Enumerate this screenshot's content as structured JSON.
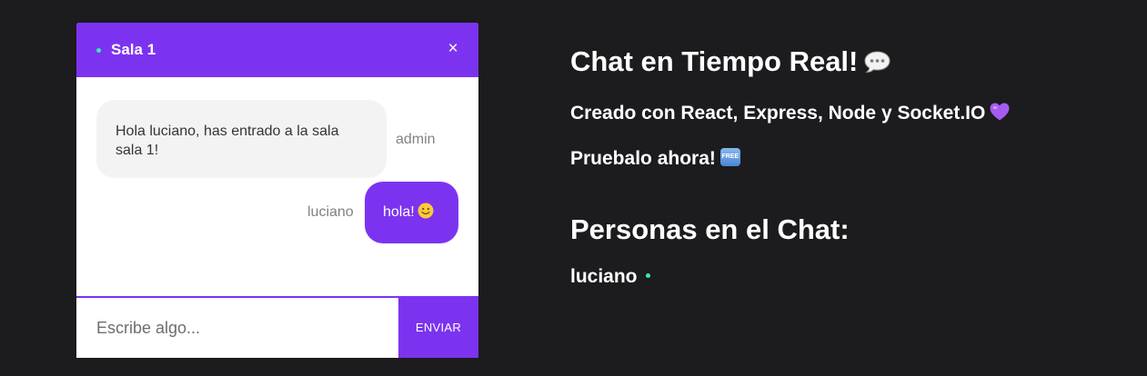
{
  "chat": {
    "room_name": "Sala 1",
    "close_label": "×",
    "messages": [
      {
        "sender": "admin",
        "text": "Hola luciano, has entrado a la sala sala 1!"
      },
      {
        "sender": "luciano",
        "text": "hola!"
      }
    ],
    "input": {
      "value": "",
      "placeholder": "Escribe algo..."
    },
    "send_label": "ENVIAR"
  },
  "info": {
    "title": "Chat en Tiempo Real!",
    "title_icon": "speech-bubble-icon",
    "subtitle": "Creado con React, Express, Node y Socket.IO",
    "subtitle_icon": "purple-heart-icon",
    "tryit": "Pruebalo ahora!",
    "tryit_icon": "free-badge-icon",
    "free_badge_text": "FREE",
    "people_title": "Personas en el Chat:",
    "people": [
      {
        "name": "luciano",
        "status": "online"
      }
    ]
  },
  "colors": {
    "background": "#1c1b1e",
    "accent": "#7c33f0",
    "online": "#3ee8b5",
    "bubble_admin": "#f3f3f3"
  }
}
